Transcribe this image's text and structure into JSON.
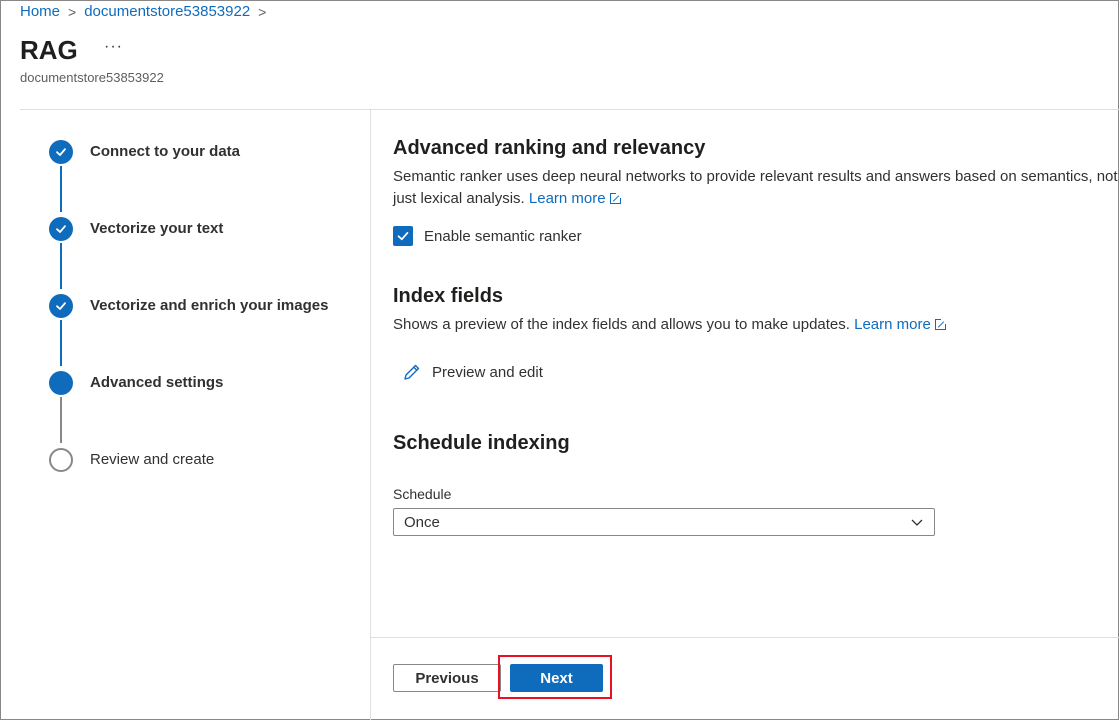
{
  "breadcrumb": {
    "home": "Home",
    "resource": "documentstore53853922"
  },
  "header": {
    "title": "RAG",
    "more": "···",
    "subtitle": "documentstore53853922"
  },
  "steps": [
    {
      "label": "Connect to your data",
      "state": "done"
    },
    {
      "label": "Vectorize your text",
      "state": "done"
    },
    {
      "label": "Vectorize and enrich your images",
      "state": "done"
    },
    {
      "label": "Advanced settings",
      "state": "current"
    },
    {
      "label": "Review and create",
      "state": "todo"
    }
  ],
  "ranking": {
    "title": "Advanced ranking and relevancy",
    "line1": "Semantic ranker uses deep neural networks to provide relevant results and answers based on semantics, not",
    "line2": "just lexical analysis.",
    "learn_more": "Learn more",
    "checkbox_label": "Enable semantic ranker",
    "checked": true
  },
  "index_fields": {
    "title": "Index fields",
    "desc": "Shows a preview of the index fields and allows you to make updates.",
    "learn_more": "Learn more",
    "edit_label": "Preview and edit"
  },
  "schedule": {
    "title": "Schedule indexing",
    "field_label": "Schedule",
    "selected": "Once"
  },
  "footer": {
    "previous": "Previous",
    "next": "Next"
  },
  "colors": {
    "accent": "#0f6cbd",
    "highlight": "#e81123"
  }
}
